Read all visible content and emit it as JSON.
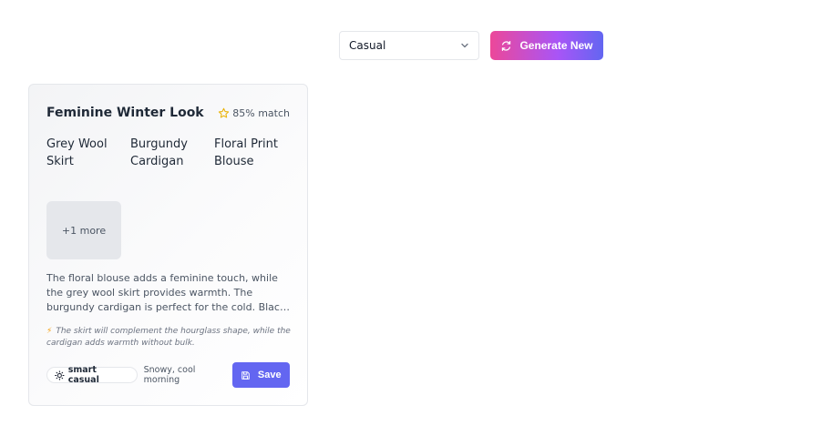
{
  "toolbar": {
    "occasion_value": "Casual",
    "generate_label": "Generate New"
  },
  "outfit": {
    "title": "Feminine Winter Look",
    "match": "85% match",
    "items": [
      {
        "alt": "Grey Wool Skirt"
      },
      {
        "alt": "Burgundy Cardigan"
      },
      {
        "alt": "Floral Print Blouse"
      }
    ],
    "more_label": "+1 more",
    "description": "The floral blouse adds a feminine touch, while the grey wool skirt provides warmth. The burgundy cardigan is perfect for the cold. Black pumps are ideal for a polished finish.",
    "tip": "The skirt will complement the hourglass shape, while the cardigan adds warmth without bulk.",
    "style_tag": "smart casual",
    "weather": "Snowy, cool morning",
    "save_label": "Save"
  },
  "colors": {
    "gradient_start": "#ec4899",
    "gradient_end": "#6366f1",
    "save_bg": "#6366f1",
    "star": "#eab308"
  },
  "icons": {
    "refresh": "refresh-icon",
    "chevron": "chevron-down-icon",
    "star": "star-icon",
    "sun": "sun-icon",
    "save": "save-icon",
    "bolt": "lightning-icon"
  }
}
